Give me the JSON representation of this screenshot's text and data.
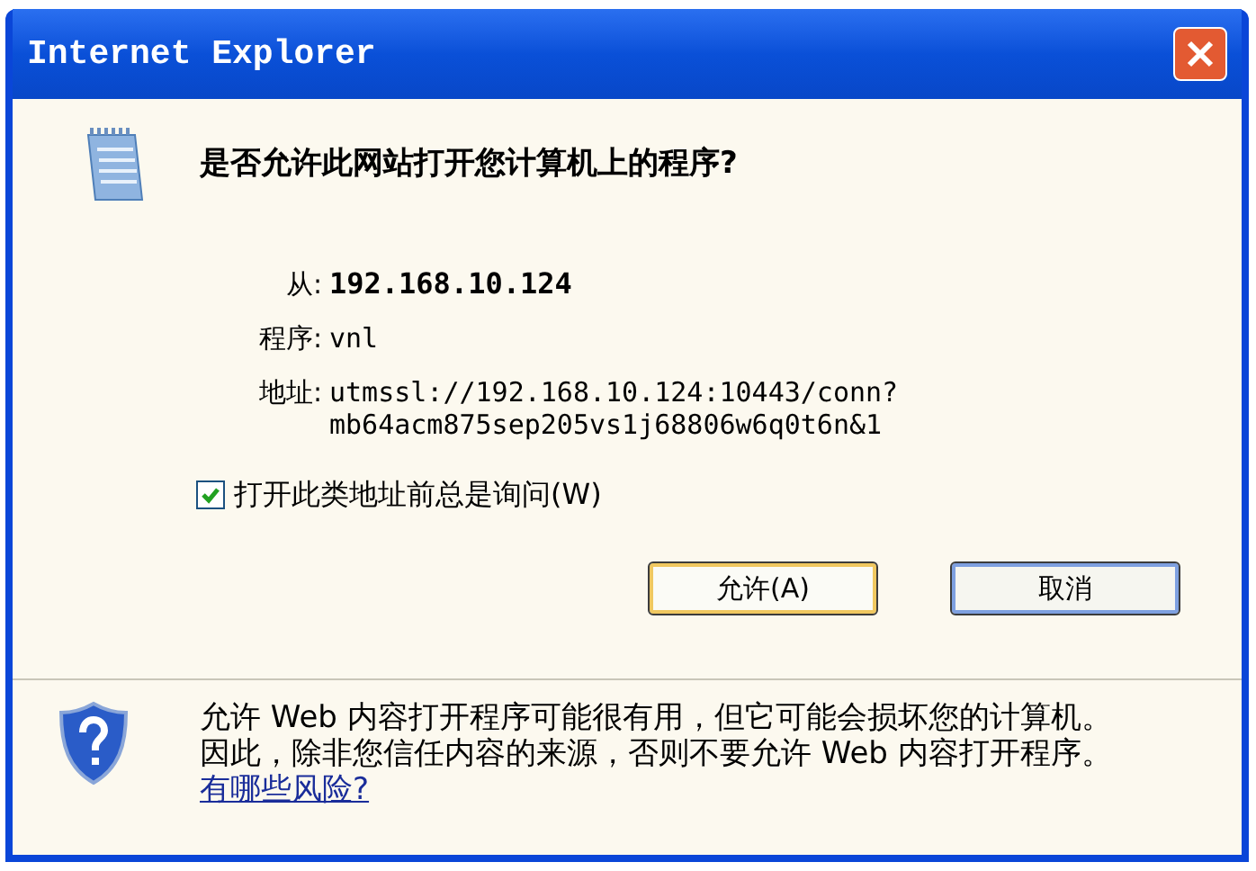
{
  "window": {
    "title": "Internet Explorer"
  },
  "question": "是否允许此网站打开您计算机上的程序?",
  "details": [
    {
      "label": "从:",
      "value": "192.168.10.124",
      "kind": "bold"
    },
    {
      "label": "程序:",
      "value": "vnl",
      "kind": "mono"
    },
    {
      "label": "地址:",
      "value": "utmssl://192.168.10.124:10443/conn?mb64acm875sep205vs1j68806w6q0t6n&1",
      "kind": "mono"
    }
  ],
  "always_ask": {
    "label": "打开此类地址前总是询问(W)",
    "checked": true
  },
  "buttons": [
    {
      "label": "允许(A)",
      "default": true
    },
    {
      "label": "取消",
      "default": false
    }
  ],
  "warning": {
    "text": "允许 Web 内容打开程序可能很有用，但它可能会损坏您的计算机。因此，除非您信任内容的来源，否则不要允许 Web 内容打开程序。",
    "link": "有哪些风险?"
  }
}
